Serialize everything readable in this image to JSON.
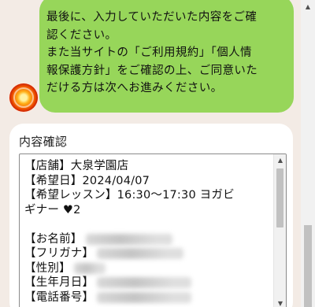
{
  "message": {
    "text": "最後に、入力していただいた内容をご確\n認ください。\nまた当サイトの「ご利用規約」「個人情\n報保護方針」をご確認の上、ご同意いた\nだける方は次へお進みください。"
  },
  "confirm": {
    "title": "内容確認",
    "shop": "【店舗】大泉学園店",
    "date": "【希望日】2024/04/07",
    "lesson_line1": "【希望レッスン】16:30〜17:30 ヨガビ",
    "lesson_line2": "ギナー ♥2",
    "name_label": "【お名前】",
    "kana_label": "【フリガナ】",
    "gender_label": "【性別】",
    "birth_label": "【生年月日】",
    "phone_label": "【電話番号】"
  },
  "scroll": {
    "up_arrow": "▲",
    "down_arrow": "▼"
  },
  "colors": {
    "bubble": "#97d65a",
    "background": "#f3ebe5",
    "card": "#ffffff"
  }
}
